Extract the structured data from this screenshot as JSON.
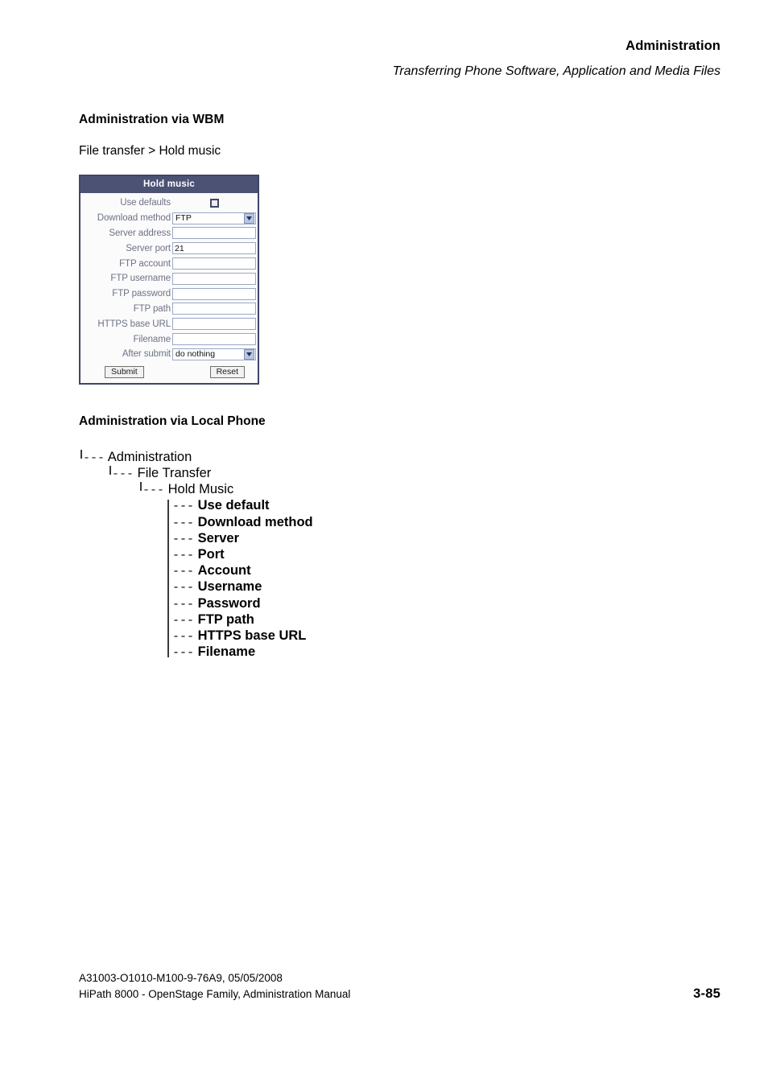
{
  "header": {
    "title": "Administration",
    "subtitle": "Transferring Phone Software, Application and Media Files"
  },
  "sections": {
    "wbm_heading": "Administration via WBM",
    "breadcrumb": "File transfer > Hold music",
    "local_phone_heading": "Administration via Local Phone"
  },
  "wbm_form": {
    "title": "Hold music",
    "rows": [
      {
        "label": "Use defaults",
        "type": "checkbox",
        "value": "",
        "checked": false
      },
      {
        "label": "Download method",
        "type": "select",
        "value": "FTP"
      },
      {
        "label": "Server address",
        "type": "text",
        "value": ""
      },
      {
        "label": "Server port",
        "type": "text",
        "value": "21"
      },
      {
        "label": "FTP account",
        "type": "text",
        "value": ""
      },
      {
        "label": "FTP username",
        "type": "text",
        "value": ""
      },
      {
        "label": "FTP password",
        "type": "text",
        "value": ""
      },
      {
        "label": "FTP path",
        "type": "text",
        "value": ""
      },
      {
        "label": "HTTPS base URL",
        "type": "text",
        "value": ""
      },
      {
        "label": "Filename",
        "type": "text",
        "value": ""
      },
      {
        "label": "After submit",
        "type": "select",
        "value": "do nothing"
      }
    ],
    "submit_label": "Submit",
    "reset_label": "Reset",
    "colors": {
      "titlebar": "#4b5274",
      "border": "#3f4768",
      "field_border": "#9aa7c4",
      "label_text": "#6d7287",
      "dropdown_button": "#b9c6e2"
    }
  },
  "tree": {
    "branch_marker": "---",
    "level1": "Administration",
    "level2": "File Transfer",
    "level3": "Hold Music",
    "leaves": [
      "Use default",
      "Download method",
      "Server",
      "Port",
      "Account",
      "Username",
      "Password",
      "FTP path",
      "HTTPS base URL",
      "Filename"
    ]
  },
  "footer": {
    "doc_id": "A31003-O1010-M100-9-76A9, 05/05/2008",
    "manual_title": "HiPath 8000 - OpenStage Family, Administration Manual",
    "page_number": "3-85"
  }
}
